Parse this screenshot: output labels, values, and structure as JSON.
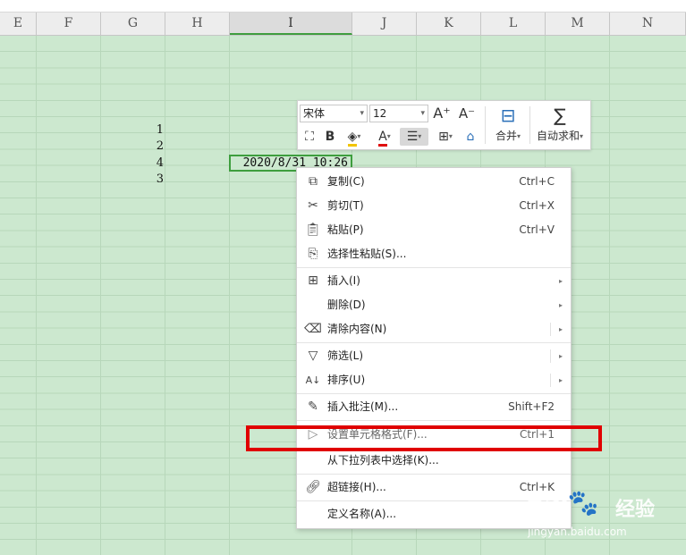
{
  "columns": [
    "E",
    "F",
    "G",
    "H",
    "I",
    "J",
    "K",
    "L",
    "M",
    "N"
  ],
  "active_column": "I",
  "cells": {
    "g_values": [
      "1",
      "2",
      "4",
      "3"
    ],
    "selected_value": "2020/8/31 10:26"
  },
  "mini_toolbar": {
    "font_name": "宋体",
    "font_size": "12",
    "increase_font": "A⁺",
    "decrease_font": "A⁻",
    "bold": "B",
    "font_color": "A",
    "merge_label": "合并",
    "autosum_label": "自动求和"
  },
  "context_menu": {
    "items": [
      {
        "label": "复制(C)",
        "shortcut": "Ctrl+C"
      },
      {
        "label": "剪切(T)",
        "shortcut": "Ctrl+X"
      },
      {
        "label": "粘贴(P)",
        "shortcut": "Ctrl+V"
      },
      {
        "label": "选择性粘贴(S)...",
        "shortcut": ""
      },
      {
        "label": "插入(I)",
        "shortcut": ""
      },
      {
        "label": "删除(D)",
        "shortcut": ""
      },
      {
        "label": "清除内容(N)",
        "shortcut": ""
      },
      {
        "label": "筛选(L)",
        "shortcut": ""
      },
      {
        "label": "排序(U)",
        "shortcut": ""
      },
      {
        "label": "插入批注(M)...",
        "shortcut": "Shift+F2"
      },
      {
        "label": "设置单元格格式(F)...",
        "shortcut": "Ctrl+1"
      },
      {
        "label": "从下拉列表中选择(K)...",
        "shortcut": ""
      },
      {
        "label": "超链接(H)...",
        "shortcut": "Ctrl+K"
      },
      {
        "label": "定义名称(A)...",
        "shortcut": ""
      }
    ]
  },
  "watermark": {
    "logo": "Bai🐾",
    "jingyan": "经验",
    "url": "jingyan.baidu.com"
  },
  "colors": {
    "grid_bg": "#cce8cf",
    "highlight": "#e00000",
    "selection": "#3e9e3e"
  }
}
